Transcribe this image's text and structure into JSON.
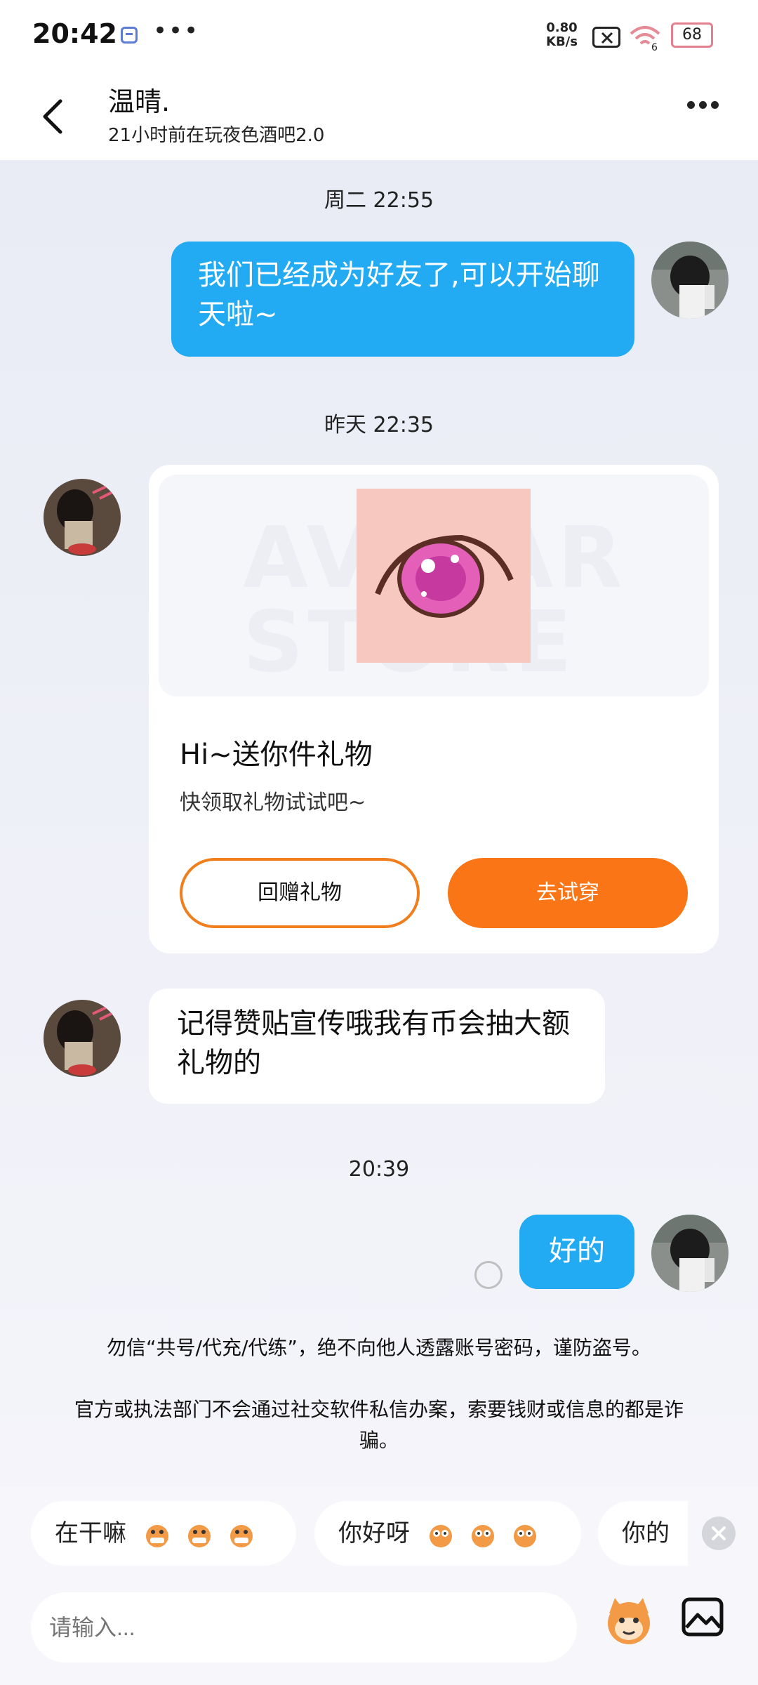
{
  "status_bar": {
    "time": "20:42",
    "speed_value": "0.80",
    "speed_unit": "KB/s",
    "network": "6",
    "battery": "68"
  },
  "header": {
    "name": "温晴.",
    "subtitle": "21小时前在玩夜色酒吧2.0"
  },
  "messages": {
    "ts1": "周二 22:55",
    "msg1": "我们已经成为好友了,可以开始聊天啦~",
    "ts2": "昨天 22:35",
    "gift": {
      "watermark": "AVATAR STORE",
      "title": "Hi~送你件礼物",
      "subtitle": "快领取礼物试试吧~",
      "return_label": "回赠礼物",
      "try_label": "去试穿"
    },
    "msg2": "记得赞贴宣传哦我有币会抽大额礼物的",
    "ts3": "20:39",
    "msg3": "好的"
  },
  "notices": {
    "n1": "勿信“共号/代充/代练”，绝不向他人透露账号密码，谨防盗号。",
    "n2": "官方或执法部门不会通过社交软件私信办案，索要钱财或信息的都是诈骗。"
  },
  "quick_replies": [
    "在干嘛",
    "你好呀",
    "你的"
  ],
  "input": {
    "placeholder": "请输入..."
  },
  "colors": {
    "my_bubble": "#22aaf2",
    "accent_orange": "#f97516"
  }
}
